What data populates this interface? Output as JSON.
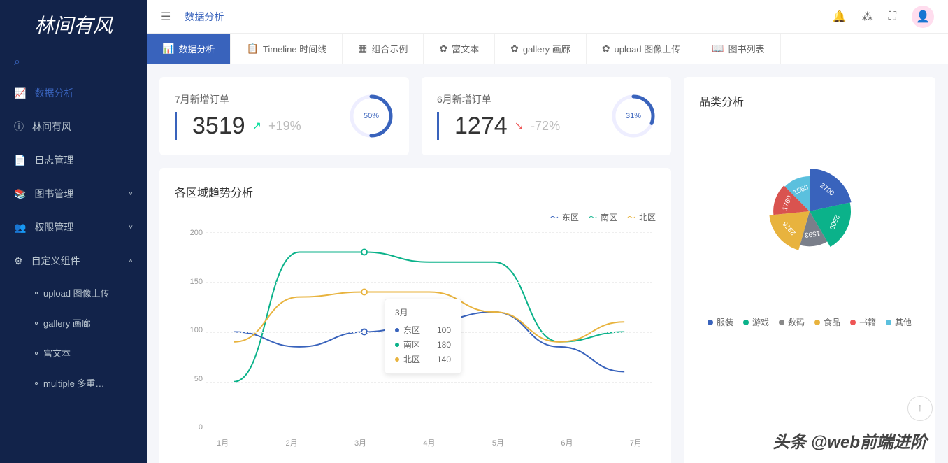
{
  "app": {
    "logo": "林间有风"
  },
  "breadcrumb": "数据分析",
  "sidebar": {
    "items": [
      {
        "icon": "chart",
        "label": "数据分析",
        "active": true
      },
      {
        "icon": "info",
        "label": "林间有风"
      },
      {
        "icon": "doc",
        "label": "日志管理"
      },
      {
        "icon": "book",
        "label": "图书管理",
        "chev": "down"
      },
      {
        "icon": "user",
        "label": "权限管理",
        "chev": "down"
      },
      {
        "icon": "gear",
        "label": "自定义组件",
        "chev": "up"
      }
    ],
    "subs": [
      {
        "label": "upload 图像上传"
      },
      {
        "label": "gallery 画廊"
      },
      {
        "label": "富文本"
      },
      {
        "label": "multiple 多重…"
      }
    ]
  },
  "tabs": [
    {
      "icon": "📊",
      "label": "数据分析",
      "active": true
    },
    {
      "icon": "📋",
      "label": "Timeline 时间线"
    },
    {
      "icon": "▦",
      "label": "组合示例"
    },
    {
      "icon": "✿",
      "label": "富文本"
    },
    {
      "icon": "✿",
      "label": "gallery 画廊"
    },
    {
      "icon": "✿",
      "label": "upload 图像上传"
    },
    {
      "icon": "📖",
      "label": "图书列表"
    }
  ],
  "stats": [
    {
      "title": "7月新增订单",
      "value": "3519",
      "dir": "up",
      "arrow": "↗",
      "change": "+19%",
      "ring": "50%",
      "pct": 50,
      "color": "#3963bc"
    },
    {
      "title": "6月新增订单",
      "value": "1274",
      "dir": "down",
      "arrow": "↘",
      "change": "-72%",
      "ring": "31%",
      "pct": 31,
      "color": "#3963bc"
    }
  ],
  "trend": {
    "title": "各区域趋势分析",
    "legend": [
      {
        "name": "东区",
        "color": "#3963bc"
      },
      {
        "name": "南区",
        "color": "#0bb28a"
      },
      {
        "name": "北区",
        "color": "#e8b33e"
      }
    ],
    "tooltip": {
      "title": "3月",
      "rows": [
        {
          "name": "东区",
          "value": "100",
          "color": "#3963bc"
        },
        {
          "name": "南区",
          "value": "180",
          "color": "#0bb28a"
        },
        {
          "name": "北区",
          "value": "140",
          "color": "#e8b33e"
        }
      ]
    }
  },
  "pie": {
    "title": "品类分析",
    "legend": [
      {
        "name": "服装",
        "color": "#3963bc"
      },
      {
        "name": "游戏",
        "color": "#0bb28a"
      },
      {
        "name": "数码",
        "color": "#888"
      },
      {
        "name": "食品",
        "color": "#e8b33e"
      },
      {
        "name": "书籍",
        "color": "#e55"
      },
      {
        "name": "其他",
        "color": "#5bc0de"
      }
    ]
  },
  "watermark": "头条 @web前端进阶",
  "chart_data": {
    "trend": {
      "type": "line",
      "categories": [
        "1月",
        "2月",
        "3月",
        "4月",
        "5月",
        "6月",
        "7月"
      ],
      "series": [
        {
          "name": "东区",
          "color": "#3963bc",
          "values": [
            100,
            85,
            100,
            110,
            120,
            85,
            60
          ]
        },
        {
          "name": "南区",
          "color": "#0bb28a",
          "values": [
            50,
            180,
            180,
            170,
            170,
            90,
            100
          ]
        },
        {
          "name": "北区",
          "color": "#e8b33e",
          "values": [
            90,
            135,
            140,
            140,
            120,
            90,
            110
          ]
        }
      ],
      "ylim": [
        0,
        200
      ],
      "yticks": [
        0,
        50,
        100,
        150,
        200
      ]
    },
    "pie": {
      "type": "pie",
      "data": [
        {
          "name": "服装",
          "value": 2700,
          "color": "#3963bc"
        },
        {
          "name": "游戏",
          "value": 2500,
          "color": "#0bb28a"
        },
        {
          "name": "数码",
          "value": 1593,
          "color": "#7a7f8a"
        },
        {
          "name": "食品",
          "value": 2376,
          "color": "#e8b33e"
        },
        {
          "name": "书籍",
          "value": 1760,
          "color": "#d9534f"
        },
        {
          "name": "其他",
          "value": 1560,
          "color": "#5bc0de"
        }
      ]
    }
  }
}
